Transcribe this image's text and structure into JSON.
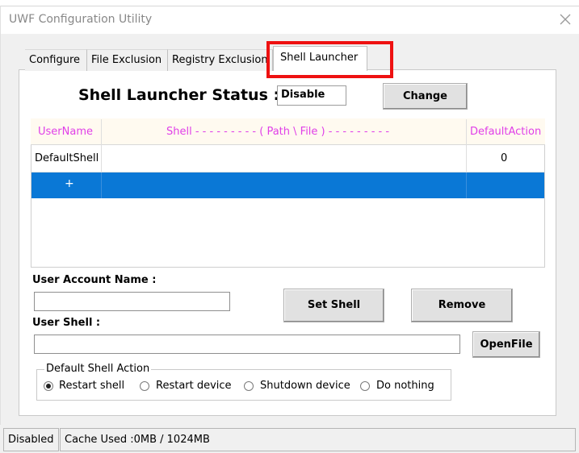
{
  "window": {
    "title": "UWF Configuration Utility"
  },
  "tabs": [
    {
      "label": "Configure"
    },
    {
      "label": "File Exclusion"
    },
    {
      "label": "Registry Exclusion"
    },
    {
      "label": "Shell Launcher"
    }
  ],
  "status": {
    "label": "Shell Launcher Status :",
    "value": "Disable",
    "change_button": "Change"
  },
  "grid": {
    "columns": [
      "UserName",
      "Shell  - - - - - - - - - ( Path \\ File ) - - - - - - - - -",
      "DefaultAction"
    ],
    "rows": [
      {
        "username": "DefaultShell",
        "shell": "",
        "default_action": "0"
      }
    ],
    "new_row_marker": "+",
    "header_color": "#e040e8",
    "selection_color": "#0a78d6"
  },
  "form": {
    "user_account_label": "User Account Name :",
    "user_account_value": "",
    "set_shell_button": "Set Shell",
    "remove_button": "Remove",
    "user_shell_label": "User Shell :",
    "user_shell_value": "",
    "openfile_button": "OpenFile"
  },
  "default_action": {
    "title": "Default Shell Action",
    "options": [
      "Restart shell",
      "Restart device",
      "Shutdown device",
      "Do nothing"
    ],
    "selected": "Restart shell"
  },
  "statusbar": {
    "state": "Disabled",
    "cache": "Cache Used :0MB / 1024MB"
  },
  "highlight_color": "#ee1111"
}
